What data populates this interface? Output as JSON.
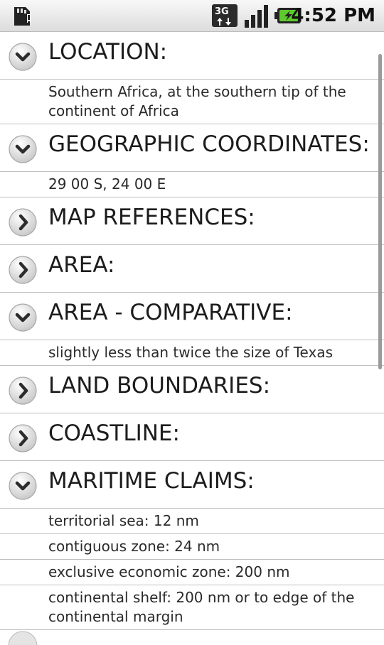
{
  "status_bar": {
    "time": "4:52 PM",
    "network": "3G",
    "icons": [
      "sd-card-warning-icon",
      "3g-data-icon",
      "signal-strength-icon",
      "battery-charging-icon"
    ]
  },
  "sections": [
    {
      "title": "LOCATION:",
      "expanded": true,
      "details": [
        "Southern Africa, at the southern tip of the continent of Africa"
      ]
    },
    {
      "title": "GEOGRAPHIC COORDINATES:",
      "expanded": true,
      "details": [
        "29 00 S, 24 00 E"
      ]
    },
    {
      "title": "MAP REFERENCES:",
      "expanded": false,
      "details": []
    },
    {
      "title": "AREA:",
      "expanded": false,
      "details": []
    },
    {
      "title": "AREA - COMPARATIVE:",
      "expanded": true,
      "details": [
        "slightly less than twice the size of Texas"
      ]
    },
    {
      "title": "LAND BOUNDARIES:",
      "expanded": false,
      "details": []
    },
    {
      "title": "COASTLINE:",
      "expanded": false,
      "details": []
    },
    {
      "title": "MARITIME CLAIMS:",
      "expanded": true,
      "details": [
        "territorial sea: 12 nm",
        "contiguous zone: 24 nm",
        "exclusive economic zone: 200 nm",
        "continental shelf: 200 nm or to edge of the continental margin"
      ]
    }
  ]
}
